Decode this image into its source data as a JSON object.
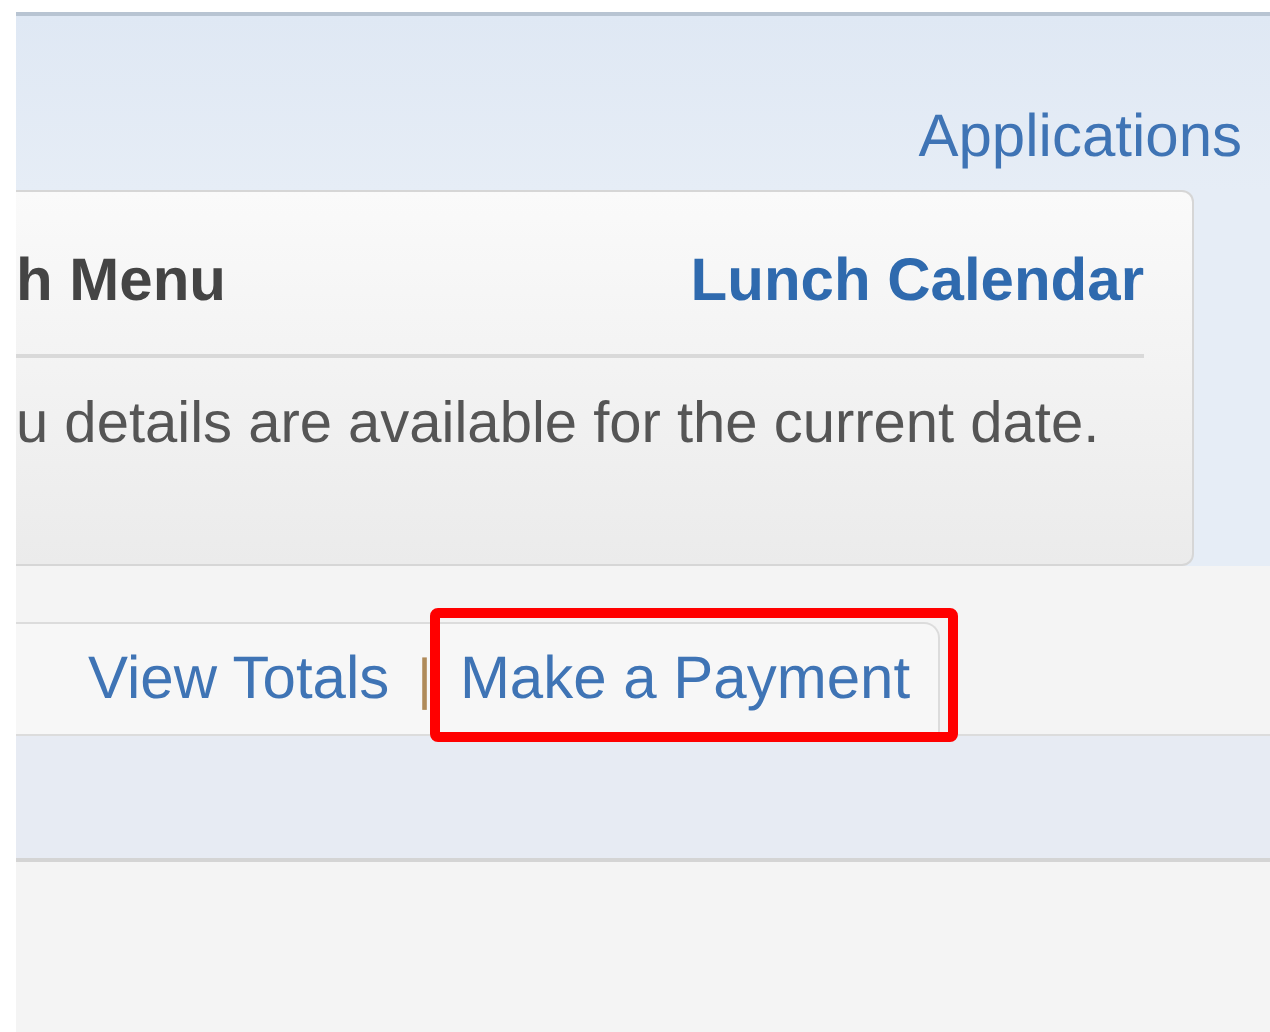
{
  "header": {
    "link": "Applications"
  },
  "lunch_menu": {
    "title": "h Menu",
    "calendar_link": "Lunch Calendar",
    "message": "u details are available for the current date."
  },
  "links": [
    {
      "label": "View Totals",
      "highlighted": false
    },
    {
      "label": "Make a Payment",
      "highlighted": true
    }
  ],
  "separator": "|"
}
